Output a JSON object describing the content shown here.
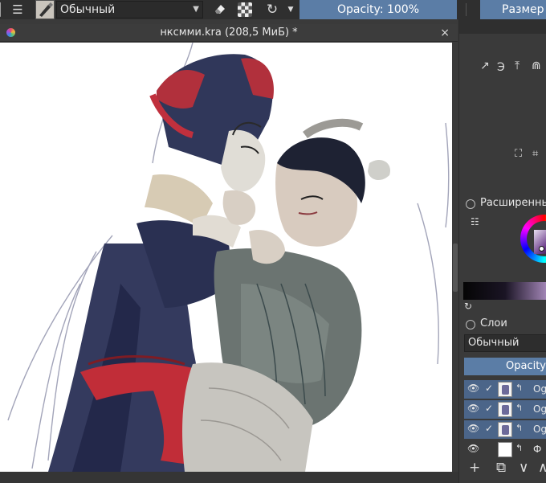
{
  "toolbar": {
    "blend_mode": "Обычный",
    "opacity": "Opacity: 100%",
    "size": "Размер"
  },
  "document": {
    "title": "нксмми.kra (208,5 МиБ) *",
    "close": "×"
  },
  "docker": {
    "advanced_color_label": "Расширенны",
    "layers_label": "Слои",
    "layer_blend_mode": "Обычный",
    "layer_opacity": "Opacity:",
    "layers": [
      {
        "name": "Og",
        "visible": true,
        "checked": true
      },
      {
        "name": "Og",
        "visible": true,
        "checked": true
      },
      {
        "name": "Og",
        "visible": true,
        "checked": true
      },
      {
        "name": "Ф",
        "visible": true,
        "checked": false
      }
    ]
  }
}
